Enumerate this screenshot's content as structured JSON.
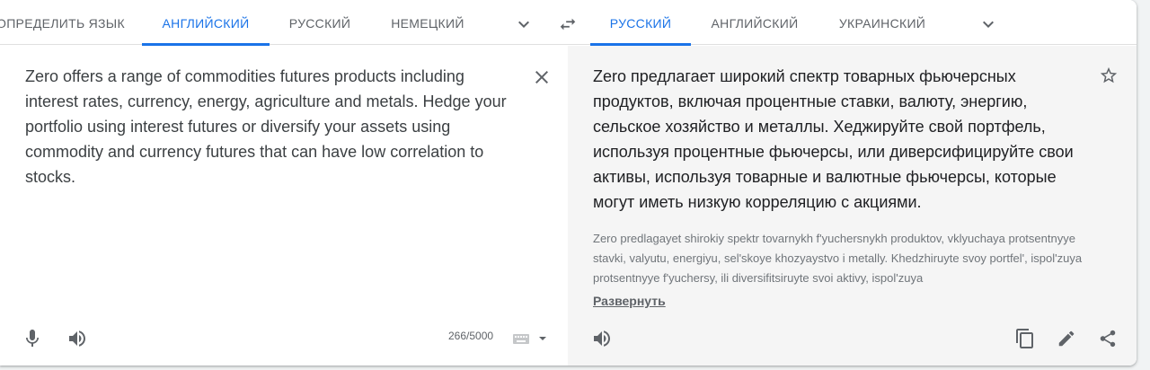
{
  "source_tabs": {
    "detect": "ОПРЕДЕЛИТЬ ЯЗЫК",
    "english": "АНГЛИЙСКИЙ",
    "russian": "РУССКИЙ",
    "german": "НЕМЕЦКИЙ"
  },
  "target_tabs": {
    "russian": "РУССКИЙ",
    "english": "АНГЛИЙСКИЙ",
    "ukrainian": "УКРАИНСКИЙ"
  },
  "source": {
    "text": "Zero offers a range of commodities futures products including interest rates, currency, energy, agriculture and metals. Hedge your portfolio using interest futures or diversify your assets using commodity and currency futures that can have low correlation to stocks.",
    "char_count": "266/5000"
  },
  "target": {
    "text": "Zero предлагает широкий спектр товарных фьючерсных продуктов, включая процентные ставки, валюту, энергию, сельское хозяйство и металлы. Хеджируйте свой портфель, используя процентные фьючерсы, или диверсифицируйте свои активы, используя товарные и валютные фьючерсы, которые могут иметь низкую корреляцию с акциями.",
    "transliteration": "Zero predlagayet shirokiy spektr tovarnykh f'yuchersnykh produktov, vklyuchaya protsentnyye stavki, valyutu, energiyu, sel'skoye khozyaystvo i metally. Khedzhiruyte svoy portfel', ispol'zuya protsentnyye f'yuchersy, ili diversifitsiruyte svoi aktivy, ispol'zuya",
    "expand_label": "Развернуть"
  },
  "colors": {
    "accent": "#1a73e8",
    "icon": "#5f6368",
    "target_bg": "#f5f5f5"
  },
  "icons": [
    "chevron-down-icon",
    "swap-icon",
    "close-icon",
    "star-icon",
    "microphone-icon",
    "speaker-icon",
    "keyboard-icon",
    "copy-icon",
    "pencil-icon",
    "share-icon"
  ]
}
